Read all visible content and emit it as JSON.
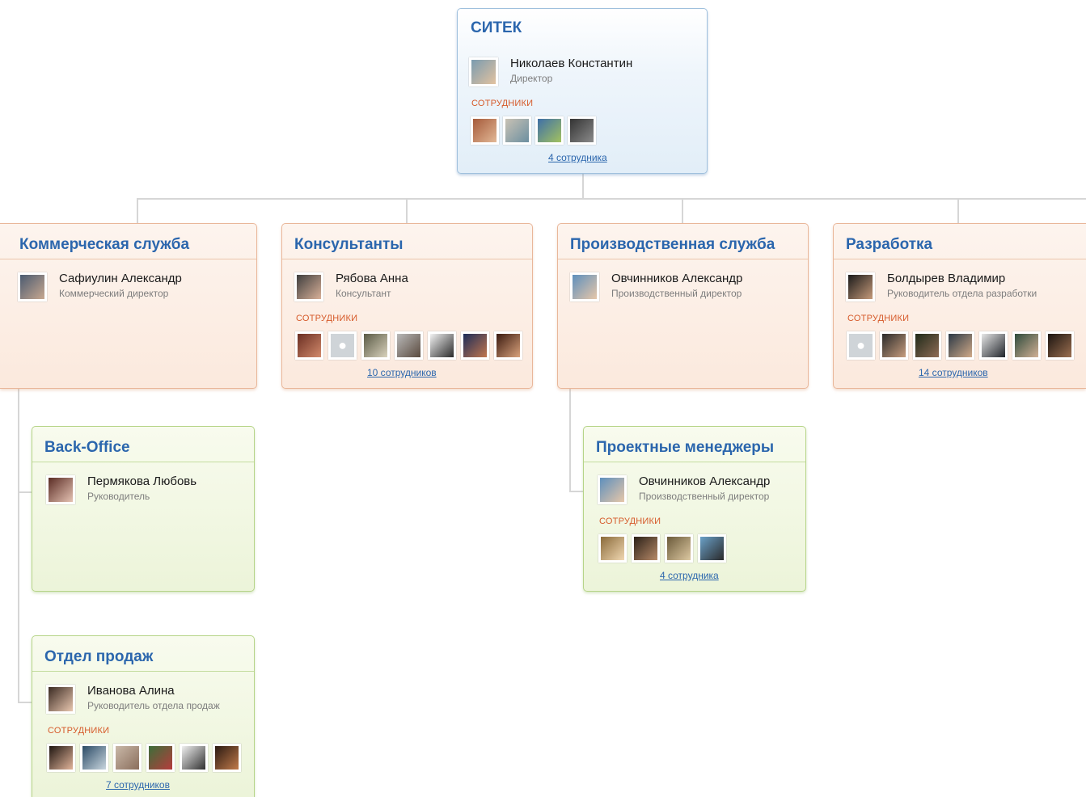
{
  "root": {
    "title": "СИТЕК",
    "head": {
      "name": "Николаев Константин",
      "role": "Директор"
    },
    "staff_label": "СОТРУДНИКИ",
    "thumbs": [
      "photo",
      "photo",
      "photo",
      "photo"
    ],
    "count": "4 сотрудника"
  },
  "departments": {
    "commercial": {
      "title": "Коммерческая служба",
      "head": {
        "name": "Сафиулин Александр",
        "role": "Коммерческий директор"
      }
    },
    "consultants": {
      "title": "Консультанты",
      "head": {
        "name": "Рябова Анна",
        "role": "Консультант"
      },
      "staff_label": "СОТРУДНИКИ",
      "thumbs": [
        "photo",
        "placeholder",
        "photo",
        "photo",
        "photo",
        "photo",
        "photo"
      ],
      "count": "10 сотрудников"
    },
    "production": {
      "title": "Производственная служба",
      "head": {
        "name": "Овчинников Александр",
        "role": "Производственный директор"
      }
    },
    "development": {
      "title": "Разработка",
      "head": {
        "name": "Болдырев Владимир",
        "role": "Руководитель отдела разработки"
      },
      "staff_label": "СОТРУДНИКИ",
      "thumbs": [
        "placeholder",
        "photo",
        "photo",
        "photo",
        "photo",
        "photo",
        "photo"
      ],
      "count": "14 сотрудников"
    },
    "backoffice": {
      "title": "Back-Office",
      "head": {
        "name": "Пермякова Любовь",
        "role": "Руководитель"
      }
    },
    "sales": {
      "title": "Отдел продаж",
      "head": {
        "name": "Иванова Алина",
        "role": "Руководитель отдела продаж"
      },
      "staff_label": "СОТРУДНИКИ",
      "thumbs": [
        "photo",
        "photo",
        "photo",
        "photo",
        "photo",
        "photo"
      ],
      "count": "7 сотрудников"
    },
    "pm": {
      "title": "Проектные менеджеры",
      "head": {
        "name": "Овчинников Александр",
        "role": "Производственный директор"
      },
      "staff_label": "СОТРУДНИКИ",
      "thumbs": [
        "photo",
        "photo",
        "photo",
        "photo"
      ],
      "count": "4 сотрудника"
    }
  },
  "colors": {
    "title_blue": "#2b66ad",
    "staff_orange": "#d65a2a",
    "root_border": "#9fc0dd",
    "dept_border": "#e9b79a",
    "sub_border": "#b6d488"
  }
}
